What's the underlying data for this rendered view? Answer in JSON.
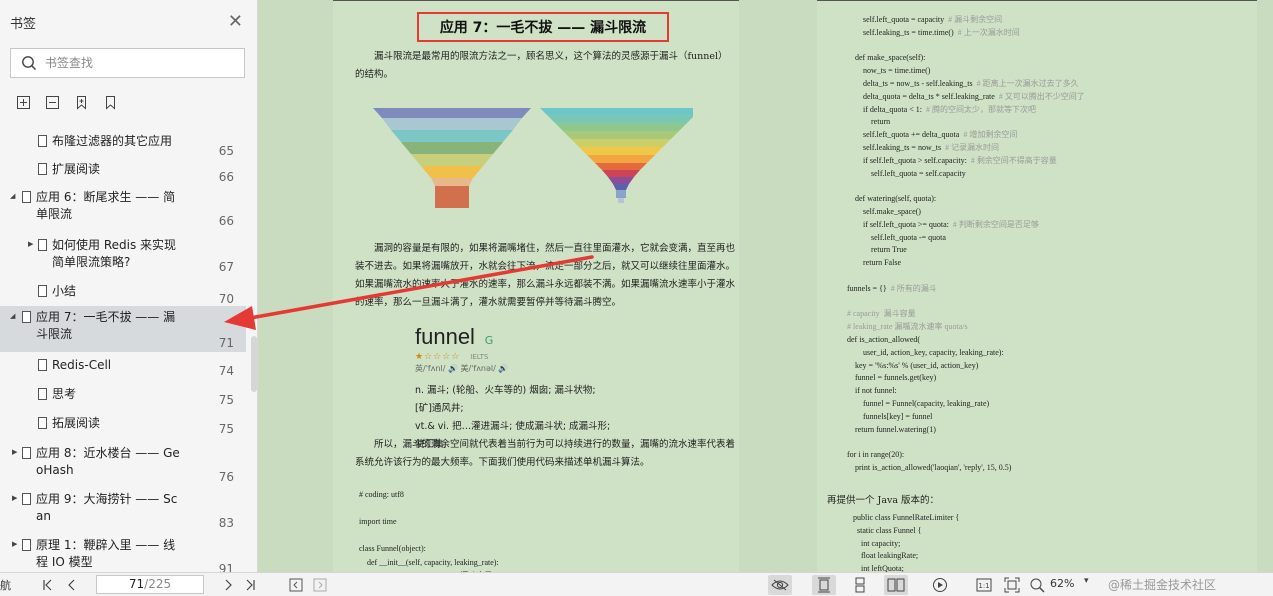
{
  "sidebar": {
    "title": "书签",
    "search_placeholder": "书签查找",
    "items": [
      {
        "label1": "布隆过滤器的其它应用",
        "label2": "",
        "page": "65",
        "arrow": "",
        "selected": false
      },
      {
        "label1": "扩展阅读",
        "label2": "",
        "page": "66",
        "arrow": "",
        "selected": false
      },
      {
        "label1": "应用 6：断尾求生 —— 简",
        "label2": "单限流",
        "page": "66",
        "arrow": "down",
        "selected": false
      },
      {
        "label1": "如何使用 Redis 来实现",
        "label2": "简单限流策略?",
        "page": "67",
        "arrow": "right",
        "selected": false
      },
      {
        "label1": "小结",
        "label2": "",
        "page": "70",
        "arrow": "",
        "selected": false
      },
      {
        "label1": "应用 7：一毛不拔 —— 漏",
        "label2": "斗限流",
        "page": "71",
        "arrow": "down",
        "selected": true
      },
      {
        "label1": "Redis-Cell",
        "label2": "",
        "page": "74",
        "arrow": "",
        "selected": false
      },
      {
        "label1": "思考",
        "label2": "",
        "page": "75",
        "arrow": "",
        "selected": false
      },
      {
        "label1": "拓展阅读",
        "label2": "",
        "page": "75",
        "arrow": "",
        "selected": false
      },
      {
        "label1": "应用 8：近水楼台 —— Ge",
        "label2": "oHash",
        "page": "76",
        "arrow": "right",
        "selected": false
      },
      {
        "label1": "应用 9：大海捞针 —— Sc",
        "label2": "an",
        "page": "83",
        "arrow": "right",
        "selected": false
      },
      {
        "label1": "原理 1：鞭辟入里 —— 线",
        "label2": "程 IO 模型",
        "page": "91",
        "arrow": "right",
        "selected": false
      }
    ]
  },
  "doc": {
    "title": "应用 7：一毛不拔 —— 漏斗限流",
    "para1": "漏斗限流是最常用的限流方法之一，顾名思义，这个算法的灵感源于漏斗（funnel）的结构。",
    "para2": "漏洞的容量是有限的，如果将漏嘴堵住，然后一直往里面灌水，它就会变满，直至再也装不进去。如果将漏嘴放开，水就会往下流，流走一部分之后，就又可以继续往里面灌水。如果漏嘴流水的速率大于灌水的速率，那么漏斗永远都装不满。如果漏嘴流水速率小于灌水的速率，那么一旦漏斗满了，灌水就需要暂停并等待漏斗腾空。",
    "para3": "所以，漏斗的剩余空间就代表着当前行为可以持续进行的数量，漏嘴的流水速率代表着系统允许该行为的最大频率。下面我们使用代码来描述单机漏斗算法。",
    "dict": {
      "word": "funnel",
      "tag": "G",
      "stars": "★☆☆☆☆",
      "level": "IELTS",
      "phonetic": "英/'fʌnl/ 🔊  美/'fʌnəl/ 🔊",
      "def1": "n. 漏斗; (轮船、火车等的) 烟囱; 漏斗状物; [矿]通风井;",
      "def2": "vt.& vi. 把…灌进漏斗; 使成漏斗状; 成漏斗形; 使汇集;"
    },
    "code_left": "# coding: utf8\n\nimport time\n\nclass Funnel(object):\n    def __init__(self, capacity, leaking_rate):\n        self.capacity = capacity  # 漏斗容量",
    "code_right_lines": [
      {
        "t": "        self.left_quota = capacity",
        "c": "# 漏斗剩余空间"
      },
      {
        "t": "        self.leaking_ts = time.time()",
        "c": "# 上一次漏水时间"
      },
      {
        "t": "",
        "c": ""
      },
      {
        "t": "    def make_space(self):",
        "c": ""
      },
      {
        "t": "        now_ts = time.time()",
        "c": ""
      },
      {
        "t": "        delta_ts = now_ts - self.leaking_ts",
        "c": "# 距离上一次漏水过去了多久"
      },
      {
        "t": "        delta_quota = delta_ts * self.leaking_rate",
        "c": "# 又可以腾出不少空间了"
      },
      {
        "t": "        if delta_quota < 1:",
        "c": "# 腾的空间太少，那就等下次吧"
      },
      {
        "t": "            return",
        "c": ""
      },
      {
        "t": "        self.left_quota += delta_quota",
        "c": "# 增加剩余空间"
      },
      {
        "t": "        self.leaking_ts = now_ts",
        "c": "# 记录漏水时间"
      },
      {
        "t": "        if self.left_quota > self.capacity:",
        "c": "# 剩余空间不得高于容量"
      },
      {
        "t": "            self.left_quota = self.capacity",
        "c": ""
      },
      {
        "t": "",
        "c": ""
      },
      {
        "t": "    def watering(self, quota):",
        "c": ""
      },
      {
        "t": "        self.make_space()",
        "c": ""
      },
      {
        "t": "        if self.left_quota >= quota:",
        "c": "# 判断剩余空间是否足够"
      },
      {
        "t": "            self.left_quota -= quota",
        "c": ""
      },
      {
        "t": "            return True",
        "c": ""
      },
      {
        "t": "        return False",
        "c": ""
      },
      {
        "t": "",
        "c": ""
      },
      {
        "t": "funnels = {}",
        "c": "# 所有的漏斗"
      },
      {
        "t": "",
        "c": ""
      },
      {
        "t": "",
        "c": "# capacity  漏斗容量"
      },
      {
        "t": "",
        "c": "# leaking_rate 漏嘴流水速率 quota/s"
      },
      {
        "t": "def is_action_allowed(",
        "c": ""
      },
      {
        "t": "        user_id, action_key, capacity, leaking_rate):",
        "c": ""
      },
      {
        "t": "    key = '%s:%s' % (user_id, action_key)",
        "c": ""
      },
      {
        "t": "    funnel = funnels.get(key)",
        "c": ""
      },
      {
        "t": "    if not funnel:",
        "c": ""
      },
      {
        "t": "        funnel = Funnel(capacity, leaking_rate)",
        "c": ""
      },
      {
        "t": "        funnels[key] = funnel",
        "c": ""
      },
      {
        "t": "    return funnel.watering(1)",
        "c": ""
      },
      {
        "t": "",
        "c": ""
      },
      {
        "t": "for i in range(20):",
        "c": ""
      },
      {
        "t": "    print is_action_allowed('laoqian', 'reply', 15, 0.5)",
        "c": ""
      }
    ],
    "java_intro": "再提供一个 Java 版本的：",
    "code_java": "public class FunnelRateLimiter {\n  static class Funnel {\n    int capacity;\n    float leakingRate;\n    int leftQuota;"
  },
  "toolbar": {
    "nav_label": "航",
    "page_current": "71",
    "page_total": "/225",
    "zoom": "62%",
    "watermark": "@稀土掘金技术社区"
  },
  "colors": {
    "highlight_red": "#e53935",
    "page_bg": "#cfe2c5",
    "sidebar_selected": "#d7dadd"
  }
}
